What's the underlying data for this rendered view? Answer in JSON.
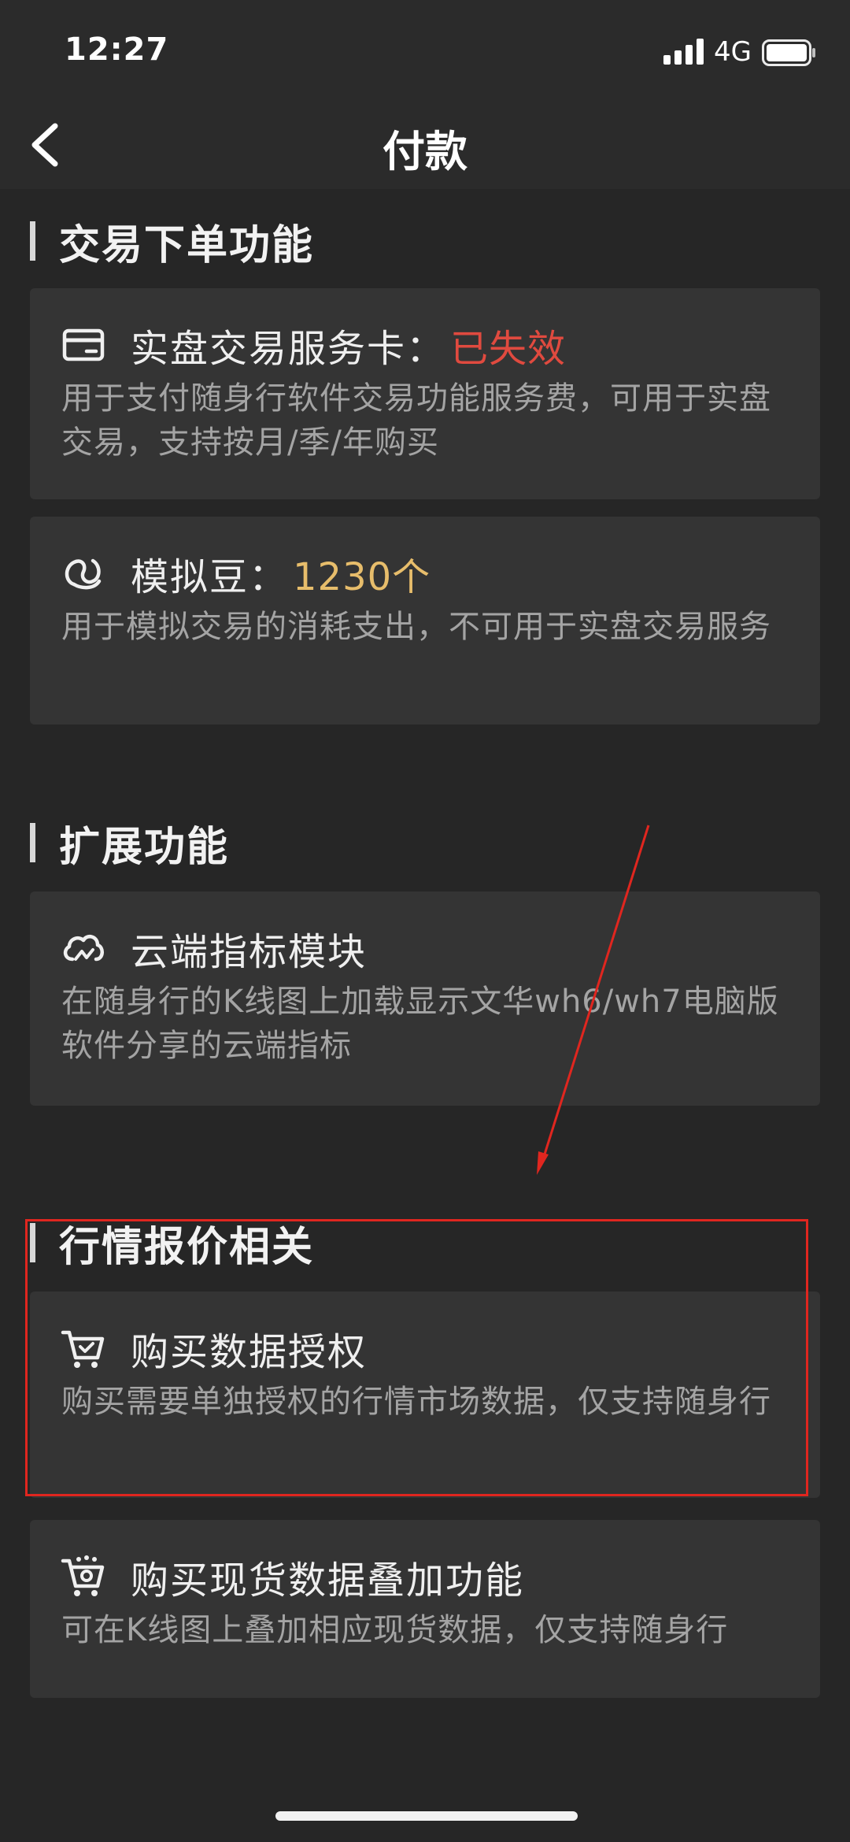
{
  "status_bar": {
    "time": "12:27",
    "network": "4G",
    "signal_icon": "cellular-signal-icon",
    "battery_icon": "battery-icon"
  },
  "nav": {
    "title": "付款",
    "back_icon": "chevron-left-icon"
  },
  "sections": [
    {
      "title": "交易下单功能",
      "cards": [
        {
          "icon": "credit-card-icon",
          "title": "实盘交易服务卡：",
          "value": "已失效",
          "value_color": "#e04a3f",
          "desc": "用于支付随身行软件交易功能服务费，可用于实盘交易，支持按月/季/年购买"
        },
        {
          "icon": "bean-icon",
          "title": "模拟豆：",
          "value": "1230个",
          "value_color": "#e7bd6b",
          "desc": "用于模拟交易的消耗支出，不可用于实盘交易服务"
        }
      ]
    },
    {
      "title": "扩展功能",
      "cards": [
        {
          "icon": "cloud-chart-icon",
          "title": "云端指标模块",
          "desc": "在随身行的K线图上加载显示文华wh6/wh7电脑版软件分享的云端指标"
        }
      ]
    },
    {
      "title": "行情报价相关",
      "cards": [
        {
          "icon": "shopping-cart-check-icon",
          "title": "购买数据授权",
          "desc": "购买需要单独授权的行情市场数据，仅支持随身行"
        },
        {
          "icon": "shopping-cart-gear-icon",
          "title": "购买现货数据叠加功能",
          "desc": "可在K线图上叠加相应现货数据，仅支持随身行"
        }
      ]
    }
  ],
  "colors": {
    "background": "#262626",
    "card": "#343434",
    "annotation": "#e0261f"
  }
}
